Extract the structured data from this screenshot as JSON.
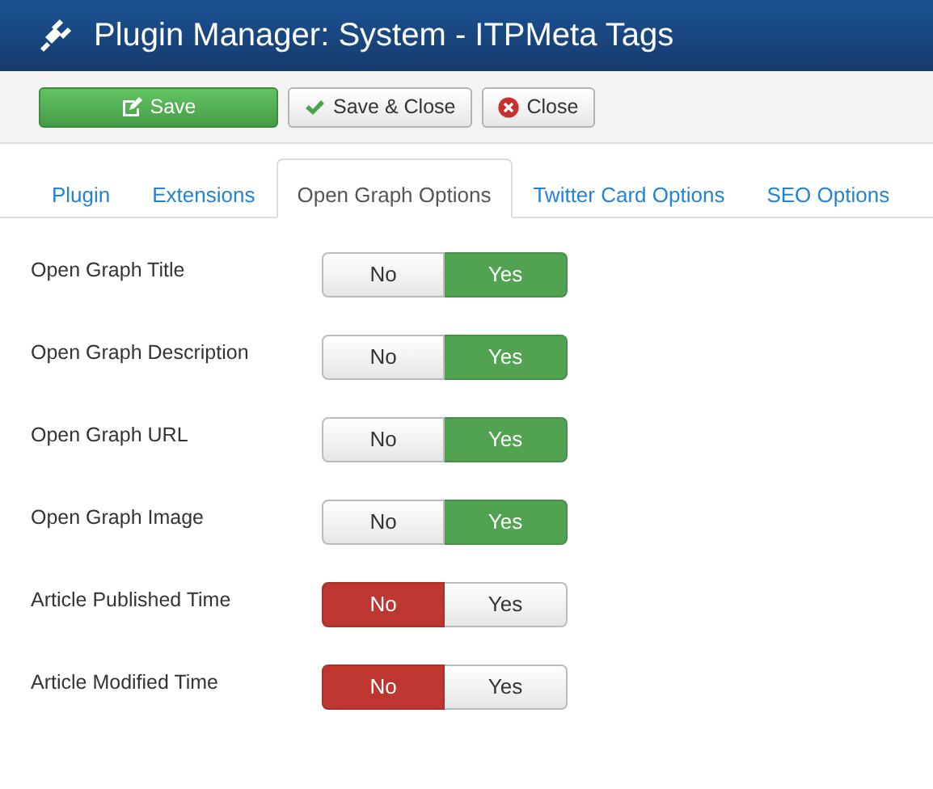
{
  "header": {
    "title": "Plugin Manager: System - ITPMeta Tags"
  },
  "toolbar": [
    {
      "label": "Save",
      "kind": "save"
    },
    {
      "label": "Save & Close",
      "kind": "save-close"
    },
    {
      "label": "Close",
      "kind": "close"
    }
  ],
  "tabs": [
    {
      "label": "Plugin",
      "selected": false
    },
    {
      "label": "Extensions",
      "selected": false
    },
    {
      "label": "Open Graph Options",
      "selected": true
    },
    {
      "label": "Twitter Card Options",
      "selected": false
    },
    {
      "label": "SEO Options",
      "selected": false
    }
  ],
  "fields": [
    {
      "label": "Open Graph Title",
      "options": [
        {
          "label": "No",
          "kind": "no",
          "selected": false
        },
        {
          "label": "Yes",
          "kind": "yes",
          "selected": true
        }
      ]
    },
    {
      "label": "Open Graph Description",
      "options": [
        {
          "label": "No",
          "kind": "no",
          "selected": false
        },
        {
          "label": "Yes",
          "kind": "yes",
          "selected": true
        }
      ]
    },
    {
      "label": "Open Graph URL",
      "options": [
        {
          "label": "No",
          "kind": "no",
          "selected": false
        },
        {
          "label": "Yes",
          "kind": "yes",
          "selected": true
        }
      ]
    },
    {
      "label": "Open Graph Image",
      "options": [
        {
          "label": "No",
          "kind": "no",
          "selected": false
        },
        {
          "label": "Yes",
          "kind": "yes",
          "selected": true
        }
      ]
    },
    {
      "label": "Article Published Time",
      "options": [
        {
          "label": "No",
          "kind": "no",
          "selected": true
        },
        {
          "label": "Yes",
          "kind": "yes",
          "selected": false
        }
      ]
    },
    {
      "label": "Article Modified Time",
      "options": [
        {
          "label": "No",
          "kind": "no",
          "selected": true
        },
        {
          "label": "Yes",
          "kind": "yes",
          "selected": false
        }
      ]
    }
  ]
}
